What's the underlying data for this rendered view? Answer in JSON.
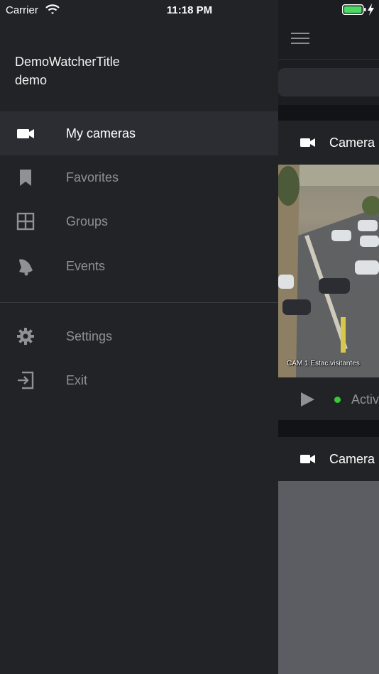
{
  "status_bar": {
    "carrier": "Carrier",
    "time": "11:18 PM"
  },
  "drawer": {
    "account_title": "DemoWatcherTitle",
    "account_user": "demo",
    "items": [
      {
        "label": "My cameras",
        "icon": "video-camera-icon",
        "active": true
      },
      {
        "label": "Favorites",
        "icon": "bookmark-icon"
      },
      {
        "label": "Groups",
        "icon": "grid-icon"
      },
      {
        "label": "Events",
        "icon": "bell-icon"
      },
      {
        "label": "Settings",
        "icon": "gear-icon"
      },
      {
        "label": "Exit",
        "icon": "exit-icon"
      }
    ]
  },
  "main": {
    "cameras": [
      {
        "title": "Camera",
        "overlay_text": "CAM 1 Estac.visitantes",
        "status": "Activ"
      },
      {
        "title": "Camera"
      }
    ]
  },
  "colors": {
    "background": "#1f2024",
    "active_item": "#2b2d33",
    "status_online": "#33cc33",
    "battery": "#4cd964"
  }
}
